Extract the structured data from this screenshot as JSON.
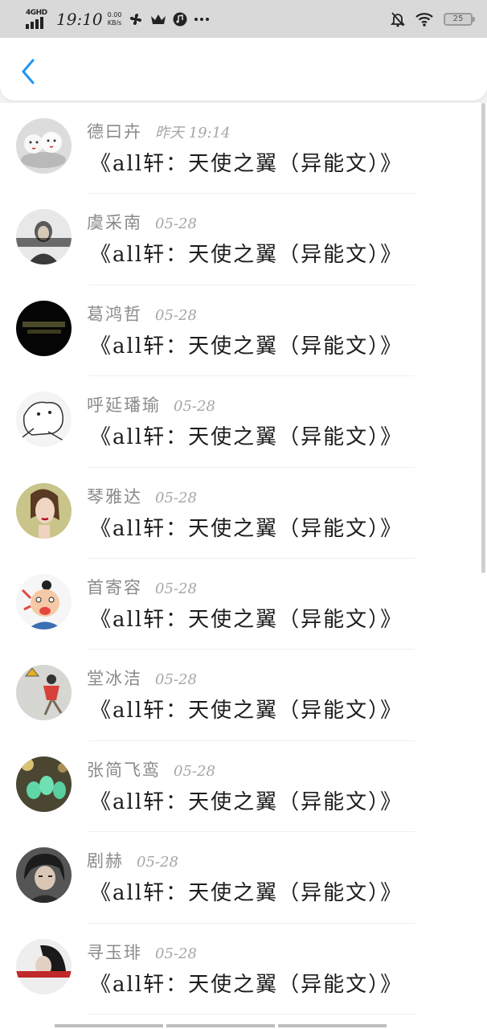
{
  "status_bar": {
    "network_type": "4GHD",
    "time": "19:10",
    "net_speed_value": "0.00",
    "net_speed_unit": "KB/s",
    "battery": "25",
    "icons": [
      "signal-icon",
      "fan-icon",
      "crown-icon",
      "music-icon",
      "more-icon",
      "mute-bell-icon",
      "wifi-icon",
      "battery-icon"
    ]
  },
  "header": {
    "back_icon": "chevron-left-icon",
    "accent_color": "#2196f3"
  },
  "messages": [
    {
      "name": "德曰卉",
      "date": "昨天 19:14",
      "text": "《all轩：天使之翼（异能文）》"
    },
    {
      "name": "虞采南",
      "date": "05-28",
      "text": "《all轩：天使之翼（异能文）》"
    },
    {
      "name": "葛鸿哲",
      "date": "05-28",
      "text": "《all轩：天使之翼（异能文）》"
    },
    {
      "name": "呼延璠瑜",
      "date": "05-28",
      "text": "《all轩：天使之翼（异能文）》"
    },
    {
      "name": "琴雅达",
      "date": "05-28",
      "text": "《all轩：天使之翼（异能文）》"
    },
    {
      "name": "首寄容",
      "date": "05-28",
      "text": "《all轩：天使之翼（异能文）》"
    },
    {
      "name": "堂冰洁",
      "date": "05-28",
      "text": "《all轩：天使之翼（异能文）》"
    },
    {
      "name": "张简飞鸾",
      "date": "05-28",
      "text": "《all轩：天使之翼（异能文）》"
    },
    {
      "name": "剧赫",
      "date": "05-28",
      "text": "《all轩：天使之翼（异能文）》"
    },
    {
      "name": "寻玉琲",
      "date": "05-28",
      "text": "《all轩：天使之翼（异能文）》"
    }
  ]
}
